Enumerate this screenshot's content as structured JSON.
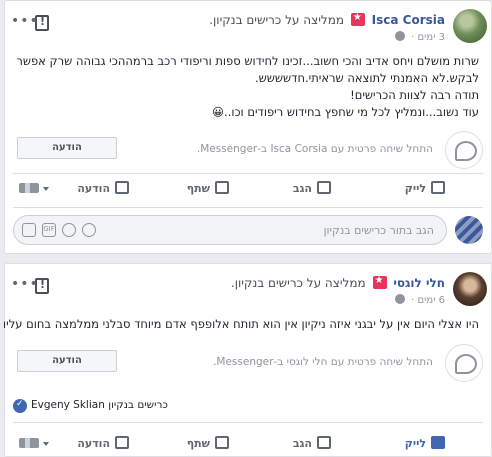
{
  "posts": [
    {
      "author": "Isca Corsia",
      "recommend_text": "ממליצה על כרישים בנקיון.",
      "time": "3 ימים",
      "body_lines": [
        "שרות מושלם ויחס אדיב והכי חשוב...זכינו לחידוש ספות וריפודי רכב ברמההכי גבוהה שרק אפשר",
        "לבקש.לא האמנתי לתוצאה שראיתי.חדשששש.",
        "תודה רבה לצוות הכרישים!",
        "עוד נשוב...ונמליץ לכל מי שחפץ בחידוש ריפודים וכו..😀"
      ],
      "messenger_text": "התחל שיחה פרטית עם Isca Corsia ב-Messenger.",
      "message_button": "הודעה",
      "actions": {
        "like": "לייק",
        "comment": "הגב",
        "share": "שתף",
        "send": "הודעה"
      },
      "comment_placeholder": "הגב בתור כרישים בנקיון",
      "input_icons": [
        "sticker",
        "GIF",
        "camera",
        "emoji"
      ]
    },
    {
      "author": "חלי לוגסי",
      "recommend_text": "ממליצה על כרישים בנקיון.",
      "time": "6 ימים",
      "body_lines": [
        "היו אצלי היום אין על יבגני איזה ניקיון אין הוא תותח אלופפף אדם מיוחד סבלני ממלמצה בחום עליו"
      ],
      "messenger_text": "התחל שיחה פרטית עם חלי לוגסי ב-Messenger.",
      "message_button": "הודעה",
      "reactions_text": "כרישים בנקיון",
      "reactions_name": "Evgeny Sklian",
      "actions": {
        "like": "לייק",
        "comment": "הגב",
        "share": "שתף",
        "send": "הודעה"
      }
    }
  ]
}
